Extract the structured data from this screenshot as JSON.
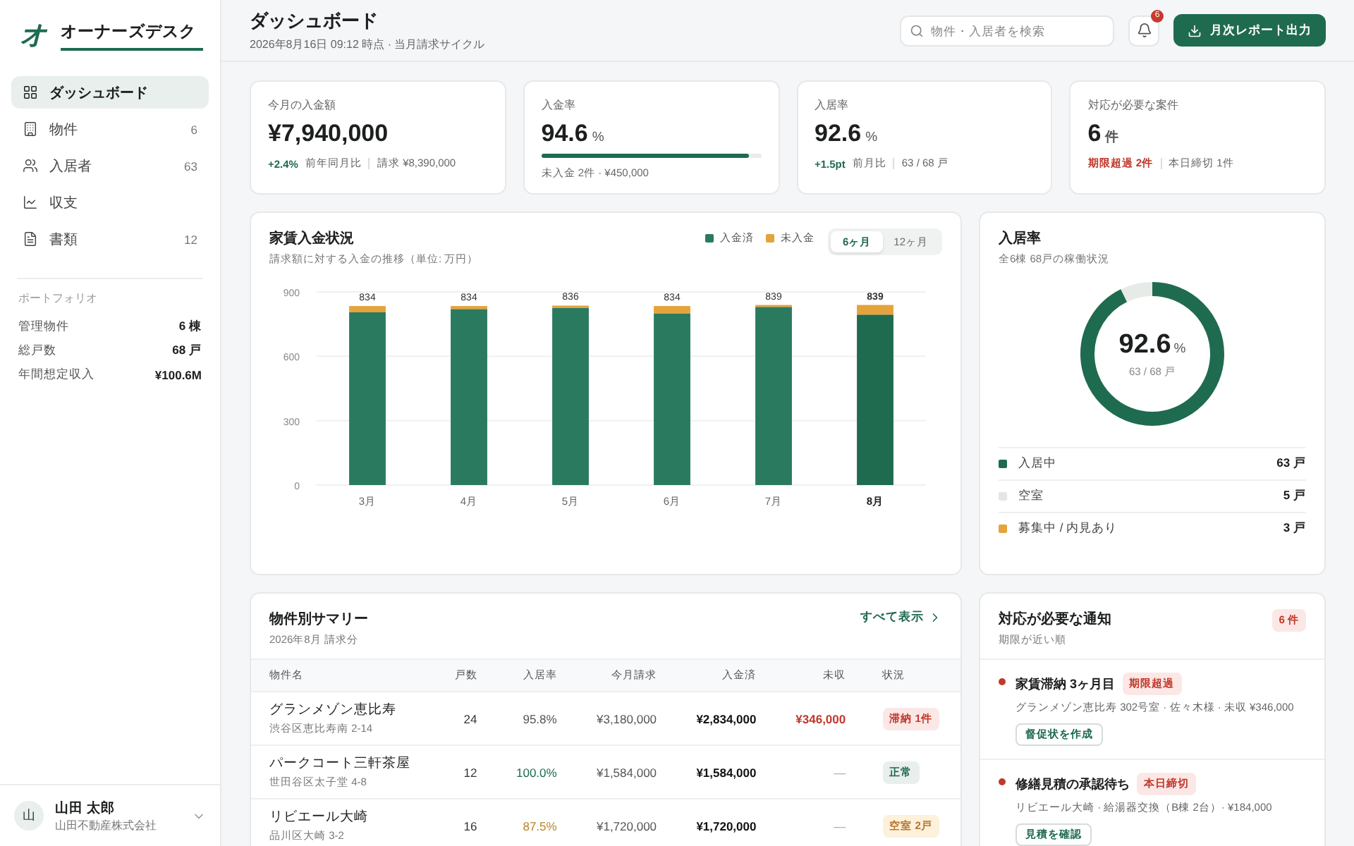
{
  "sidebar": {
    "logo_mark": "オ",
    "app_name": "オーナーズデスク",
    "nav": [
      {
        "kind": "dashboard",
        "label": "ダッシュボード",
        "selected": true
      },
      {
        "kind": "building",
        "label": "物件",
        "count": "6",
        "selected": false
      },
      {
        "kind": "people",
        "label": "入居者",
        "count": "63",
        "selected": false
      },
      {
        "kind": "chart",
        "label": "収支",
        "selected": false
      },
      {
        "kind": "document",
        "label": "書類",
        "count": "12",
        "selected": false
      }
    ],
    "portfolio_title": "ポートフォリオ",
    "portfolio": [
      {
        "label": "管理物件",
        "value": "6 棟"
      },
      {
        "label": "総戸数",
        "value": "68 戸"
      },
      {
        "label": "年間想定収入",
        "value": "¥100.6M"
      }
    ],
    "user": {
      "avatar": "山",
      "name": "山田 太郎",
      "company": "山田不動産株式会社"
    }
  },
  "header": {
    "title": "ダッシュボード",
    "subtitle": "2026年8月16日 09:12 時点 · 当月請求サイクル",
    "search_placeholder": "物件・入居者を検索",
    "notification_count": "6",
    "export_button": "月次レポート出力"
  },
  "kpis": [
    {
      "kind": "amount",
      "label": "今月の入金額",
      "value": "¥7,940,000",
      "delta": "+2.4%",
      "delta_label": "前年同月比",
      "note": "請求 ¥8,390,000"
    },
    {
      "kind": "progress",
      "label": "入金率",
      "value": "94.6",
      "unit": "%",
      "level": 0.946,
      "note": "未入金 2件 · ¥450,000"
    },
    {
      "kind": "amount",
      "label": "入居率",
      "value": "92.6",
      "unit": "%",
      "delta": "+1.5pt",
      "delta_label": "前月比",
      "note": "63 / 68 戸"
    },
    {
      "kind": "alert",
      "label": "対応が必要な案件",
      "value": "6",
      "unit": "件",
      "alert": "期限超過 2件",
      "note": "本日締切 1件"
    }
  ],
  "rent_chart": {
    "title": "家賃入金状況",
    "subtitle": "請求額に対する入金の推移（単位: 万円）",
    "ranges": [
      {
        "label": "6ヶ月",
        "selected": true
      },
      {
        "label": "12ヶ月",
        "selected": false
      }
    ],
    "chart_data": {
      "type": "bar",
      "stacked": true,
      "categories": [
        "3月",
        "4月",
        "5月",
        "6月",
        "7月",
        "8月"
      ],
      "series": [
        {
          "name": "入金済",
          "color": "#2a7a5f",
          "values": [
            805,
            820,
            826,
            800,
            830,
            794
          ]
        },
        {
          "name": "未入金",
          "color": "#e5a33b",
          "values": [
            29,
            14,
            10,
            34,
            9,
            45
          ]
        }
      ],
      "ylim": [
        0,
        900
      ],
      "yticks": [
        0,
        300,
        600,
        900
      ],
      "value_labels": [
        "834",
        "834",
        "836",
        "834",
        "839",
        "839"
      ]
    }
  },
  "occupancy": {
    "title": "入居率",
    "subtitle": "全6棟 68戸の稼働状況",
    "ring": {
      "level": 0.926
    },
    "value": "92.6",
    "unit": "%",
    "note": "63 / 68 戸",
    "legend": [
      {
        "label": "入居中",
        "value": "63 戸",
        "color": "#1f6b4f"
      },
      {
        "label": "空室",
        "value": "5 戸",
        "color": "#e3e6e4"
      },
      {
        "label": "募集中 / 内見あり",
        "value": "3 戸",
        "color": "#e5a33b"
      }
    ]
  },
  "summary": {
    "title": "物件別サマリー",
    "subtitle": "2026年8月 請求分",
    "view_all": "すべて表示",
    "columns": [
      "物件名",
      "戸数",
      "入居率",
      "今月請求",
      "入金済",
      "未収",
      "状況"
    ],
    "rows": [
      {
        "name": "グランメゾン恵比寿",
        "address": "渋谷区恵比寿南 2-14",
        "units": "24",
        "rate": "95.8%",
        "billed": "¥3,180,000",
        "paid": "¥2,834,000",
        "unpaid": "¥346,000",
        "unpaid_overdue": true,
        "status": "滞納 1件",
        "kind": "overdue"
      },
      {
        "name": "パークコート三軒茶屋",
        "address": "世田谷区太子堂 4-8",
        "units": "12",
        "rate": "100.0%",
        "billed": "¥1,584,000",
        "paid": "¥1,584,000",
        "unpaid": "—",
        "unpaid_overdue": false,
        "status": "正常",
        "kind": "normal"
      },
      {
        "name": "リビエール大崎",
        "address": "品川区大崎 3-2",
        "units": "16",
        "rate": "87.5%",
        "billed": "¥1,720,000",
        "paid": "¥1,720,000",
        "unpaid": "—",
        "unpaid_overdue": false,
        "status": "空室 2戸",
        "kind": "vacancy"
      }
    ]
  },
  "notices": {
    "title": "対応が必要な通知",
    "subtitle": "期限が近い順",
    "count": "6 件",
    "items": [
      {
        "title": "家賃滞納 3ヶ月目",
        "tag": "期限超過",
        "detail": "グランメゾン恵比寿 302号室 · 佐々木様 · 未収 ¥346,000",
        "action": "督促状を作成"
      },
      {
        "title": "修繕見積の承認待ち",
        "tag": "本日締切",
        "detail": "リビエール大崎 · 給湯器交換（B棟 2台）· ¥184,000",
        "action": "見積を確認"
      }
    ]
  }
}
